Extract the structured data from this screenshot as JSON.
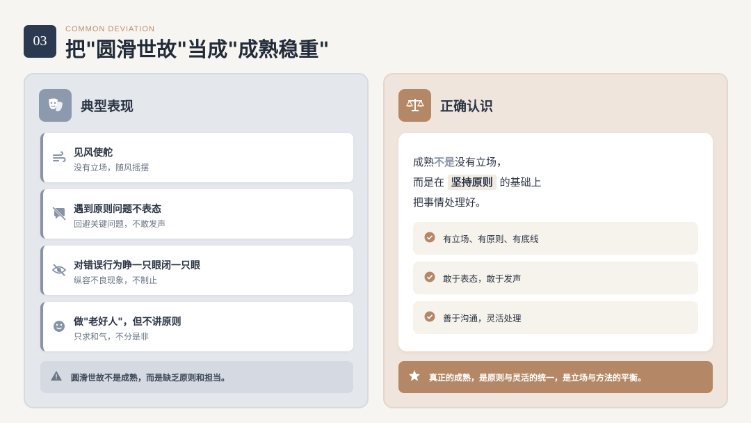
{
  "header": {
    "number": "03",
    "eyebrow": "COMMON DEVIATION",
    "title": "把\"圆滑世故\"当成\"成熟稳重\""
  },
  "left": {
    "title": "典型表现",
    "icon": "theater-mask-icon",
    "items": [
      {
        "icon": "wind-icon",
        "title": "见风使舵",
        "sub": "没有立场，随风摇摆"
      },
      {
        "icon": "muted-comment-icon",
        "title": "遇到原则问题不表态",
        "sub": "回避关键问题，不敢发声"
      },
      {
        "icon": "eye-slash-icon",
        "title": "对错误行为睁一只眼闭一只眼",
        "sub": "纵容不良现象，不制止"
      },
      {
        "icon": "smile-icon",
        "title": "做\"老好人\"，但不讲原则",
        "sub": "只求和气，不分是非"
      }
    ],
    "warning": "圆滑世故不是成熟，而是缺乏原则和担当。"
  },
  "right": {
    "title": "正确认识",
    "icon": "balance-scale-icon",
    "statement": {
      "l1_a": "成熟",
      "l1_hl": "不是",
      "l1_b": "没有立场，",
      "l2_a": "而是在",
      "l2_box": "坚持原则",
      "l2_b": "的基础上",
      "l3": "把事情处理好。"
    },
    "checks": [
      "有立场、有原则、有底线",
      "敢于表态，敢于发声",
      "善于沟通，灵活处理"
    ],
    "summary": "真正的成熟，是原则与灵活的统一，是立场与方法的平衡。"
  },
  "colors": {
    "navy": "#2b3a50",
    "slate": "#8893a6",
    "brown": "#b48866",
    "accent": "#b98f6a"
  }
}
